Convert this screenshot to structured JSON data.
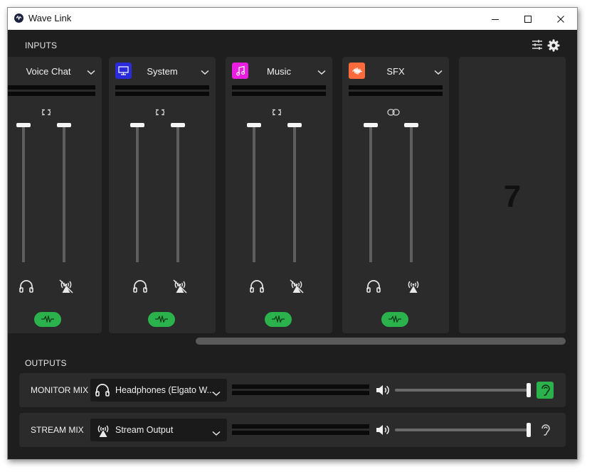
{
  "window": {
    "title": "Wave Link"
  },
  "inputs": {
    "label": "INPUTS",
    "channels": [
      {
        "name": "Voice Chat",
        "icon": "voice-chat-icon",
        "icon_color": "",
        "linked": false,
        "monitor_level": 1.0,
        "stream_level": 1.0,
        "stream_muted": true,
        "effects_on": true
      },
      {
        "name": "System",
        "icon": "monitor-icon",
        "icon_color": "#2b2bd9",
        "linked": false,
        "monitor_level": 1.0,
        "stream_level": 1.0,
        "stream_muted": true,
        "effects_on": true
      },
      {
        "name": "Music",
        "icon": "music-note-icon",
        "icon_color": "#e91ee0",
        "linked": false,
        "monitor_level": 1.0,
        "stream_level": 1.0,
        "stream_muted": true,
        "effects_on": true
      },
      {
        "name": "SFX",
        "icon": "waveform-icon",
        "icon_color": "#ff6a3d",
        "linked": true,
        "monitor_level": 1.0,
        "stream_level": 1.0,
        "stream_muted": false,
        "effects_on": true
      }
    ],
    "empty_slot": {
      "number": "7"
    }
  },
  "outputs": {
    "label": "OUTPUTS",
    "rows": [
      {
        "name": "MONITOR MIX",
        "device": "Headphones (Elgato W...",
        "device_icon": "headphones-icon",
        "volume": 1.0,
        "listening": true
      },
      {
        "name": "STREAM MIX",
        "device": "Stream Output",
        "device_icon": "broadcast-icon",
        "volume": 1.0,
        "listening": false
      }
    ]
  },
  "colors": {
    "accent": "#2bb24c",
    "panel": "#2b2b2b",
    "background": "#1e1e1e"
  }
}
